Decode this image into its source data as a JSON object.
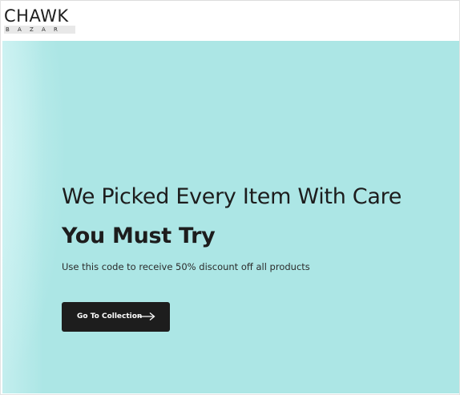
{
  "header": {
    "logo_main": "CHAWK",
    "logo_sub": "BAZAR"
  },
  "hero": {
    "heading": "We Picked Every Item With Care",
    "subheading": "You Must Try",
    "promo_text": "Use this code to receive 50% discount off all products",
    "cta_label": "Go To Collection",
    "cta_icon": "arrow-right-icon",
    "background_color": "#ace6e5",
    "button_color": "#1d1d1d"
  }
}
